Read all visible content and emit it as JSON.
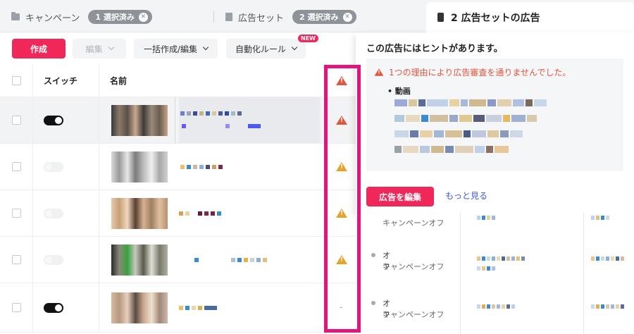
{
  "breadcrumb": {
    "campaign_label": "キャンペーン",
    "campaign_badge": "1 選択済み",
    "adset_label": "広告セット",
    "adset_badge": "2 選択済み",
    "ads_tab": "2 広告セットの広告"
  },
  "toolbar": {
    "create": "作成",
    "edit": "編集",
    "bulk": "一括作成/編集",
    "automation": "自動化ルール",
    "new_badge": "NEW"
  },
  "table": {
    "headers": {
      "switch": "スイッチ",
      "name": "名前"
    },
    "rows": [
      {
        "toggle": "on",
        "warning": "red",
        "selected": true
      },
      {
        "toggle": "off",
        "warning": "amber",
        "selected": false
      },
      {
        "toggle": "off",
        "warning": "amber",
        "selected": false
      },
      {
        "toggle": "off",
        "warning": "amber",
        "selected": false
      },
      {
        "toggle": "on",
        "warning": "none",
        "selected": false
      }
    ],
    "empty_warning": "-"
  },
  "popover": {
    "title": "この広告にはヒントがあります。",
    "error": "1つの理由により広告審査を通りませんでした。",
    "item": "• 動画",
    "edit_button": "広告を編集",
    "more_link": "もっと見る"
  },
  "status_rows": [
    {
      "line1": "",
      "line2": "キャンペーンオフ"
    },
    {
      "line1": "オフ",
      "line2": "キャンペーンオフ"
    },
    {
      "line1": "オフ",
      "line2": "キャンペーンオフ"
    }
  ],
  "colors": {
    "accent": "#f0285a",
    "warning_red": "#e2553f",
    "warning_amber": "#e9a12a",
    "highlight": "#e0157d",
    "link": "#3b5bdb"
  }
}
